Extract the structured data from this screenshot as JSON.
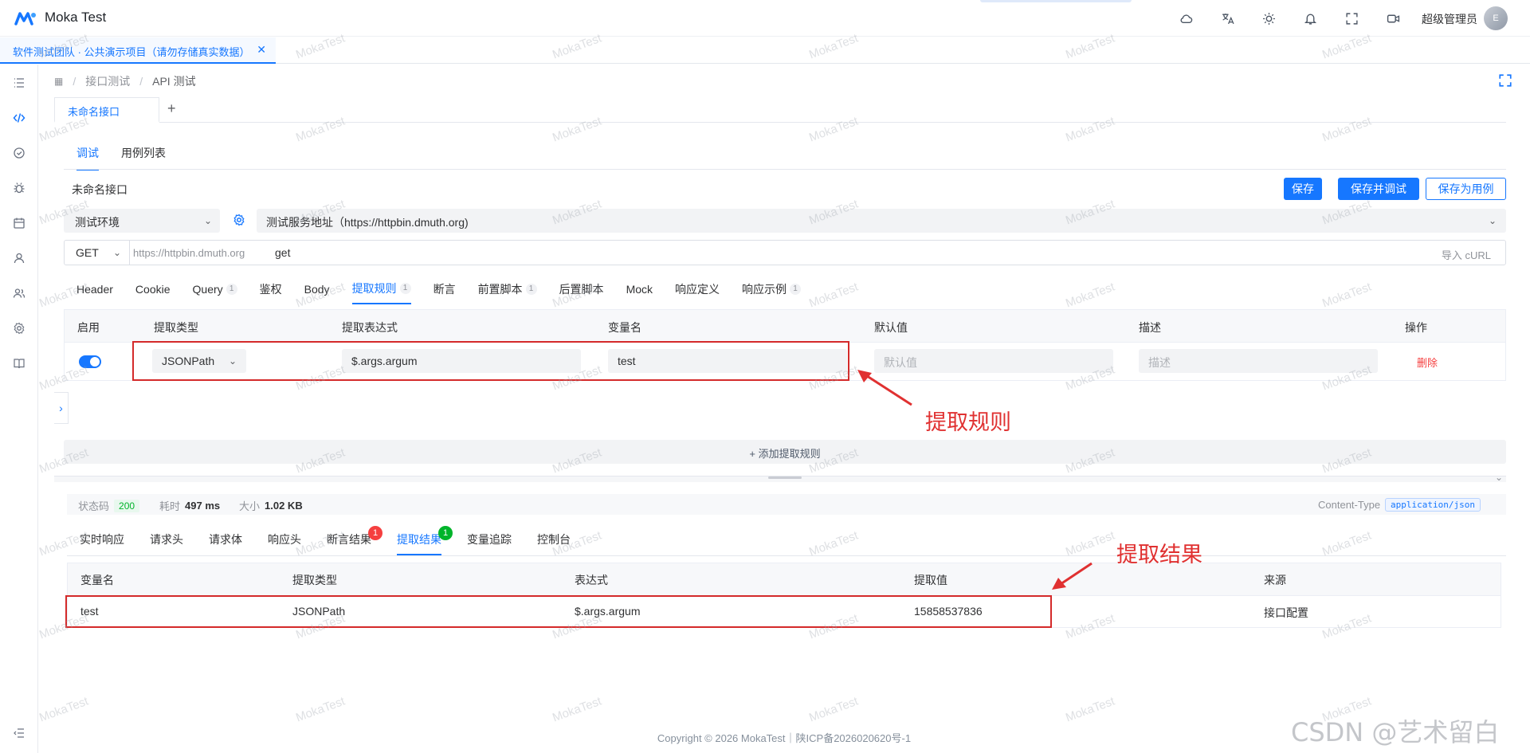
{
  "app": {
    "title": "Moka Test"
  },
  "header": {
    "user_name": "超级管理员",
    "avatar_text": "E"
  },
  "project_tab": {
    "label": "软件测试团队 · 公共演示项目（请勿存储真实数据）"
  },
  "breadcrumb": {
    "items": [
      "接口测试",
      "API 测试"
    ]
  },
  "api_tab": {
    "label": "未命名接口",
    "add": "+"
  },
  "subtabs": [
    "调试",
    "用例列表"
  ],
  "api_name": "未命名接口",
  "buttons": {
    "save": "保存",
    "save_debug": "保存并调试",
    "save_case": "保存为用例"
  },
  "environment": {
    "selected": "测试环境",
    "server": "测试服务地址（https://httpbin.dmuth.org)"
  },
  "request": {
    "method": "GET",
    "base_url": "https://httpbin.dmuth.org",
    "path": "get",
    "import_curl": "导入 cURL"
  },
  "request_tabs": [
    {
      "label": "Header",
      "count": ""
    },
    {
      "label": "Cookie",
      "count": ""
    },
    {
      "label": "Query",
      "count": "1"
    },
    {
      "label": "鉴权",
      "count": ""
    },
    {
      "label": "Body",
      "count": ""
    },
    {
      "label": "提取规则",
      "count": "1"
    },
    {
      "label": "断言",
      "count": ""
    },
    {
      "label": "前置脚本",
      "count": "1"
    },
    {
      "label": "后置脚本",
      "count": ""
    },
    {
      "label": "Mock",
      "count": ""
    },
    {
      "label": "响应定义",
      "count": ""
    },
    {
      "label": "响应示例",
      "count": "1"
    }
  ],
  "rules_table": {
    "headers": {
      "enable": "启用",
      "type": "提取类型",
      "expression": "提取表达式",
      "var": "变量名",
      "default": "默认值",
      "desc": "描述",
      "op": "操作"
    },
    "row": {
      "type": "JSONPath",
      "expression": "$.args.argum",
      "var": "test",
      "default_placeholder": "默认值",
      "desc_placeholder": "描述",
      "delete": "删除"
    },
    "add_rule": "+ 添加提取规则"
  },
  "response": {
    "status_label": "状态码",
    "status_code": "200",
    "time_label": "耗时",
    "time_value": "497 ms",
    "size_label": "大小",
    "size_value": "1.02 KB",
    "content_type_label": "Content-Type",
    "content_type": "application/json"
  },
  "response_tabs": [
    {
      "label": "实时响应",
      "badge": ""
    },
    {
      "label": "请求头",
      "badge": ""
    },
    {
      "label": "请求体",
      "badge": ""
    },
    {
      "label": "响应头",
      "badge": ""
    },
    {
      "label": "断言结果",
      "badge": "1"
    },
    {
      "label": "提取结果",
      "badge": "1"
    },
    {
      "label": "变量追踪",
      "badge": ""
    },
    {
      "label": "控制台",
      "badge": ""
    }
  ],
  "result_table": {
    "headers": {
      "var": "变量名",
      "type": "提取类型",
      "expression": "表达式",
      "value": "提取值",
      "source": "来源"
    },
    "row": {
      "var": "test",
      "type": "JSONPath",
      "expression": "$.args.argum",
      "value": "15858537836",
      "source": "接口配置"
    }
  },
  "annotations": {
    "rules": "提取规则",
    "results": "提取结果"
  },
  "footer": {
    "text": "Copyright © 2026 MokaTest｜陕ICP备2026020620号-1"
  },
  "corner_watermark": "CSDN @艺术留白",
  "watermark_text": "MokaTest",
  "colors": {
    "primary": "#1677ff",
    "danger": "#f53f3f",
    "success": "#00b42a",
    "annotation": "#e03131"
  }
}
